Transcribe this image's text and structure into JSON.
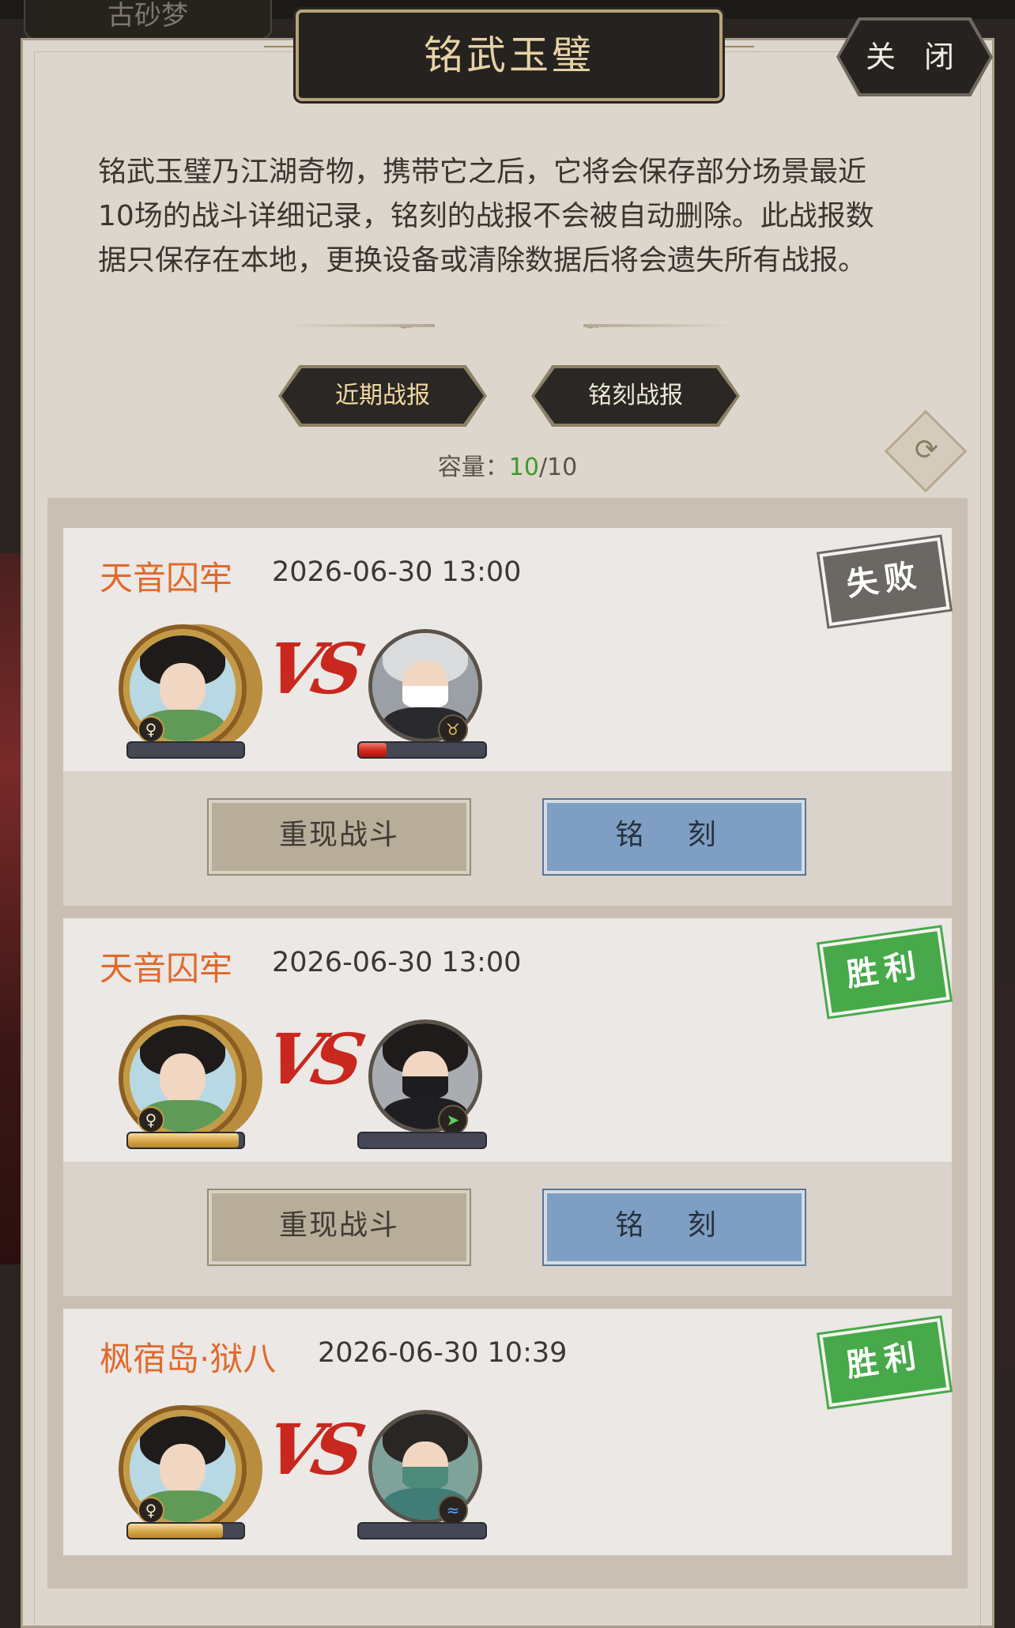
{
  "top_tab": {
    "label": "古砂梦"
  },
  "header": {
    "title": "铭武玉璧",
    "close_label": "关 闭"
  },
  "description": "铭武玉璧乃江湖奇物，携带它之后，它将会保存部分场景最近10场的战斗详细记录，铭刻的战报不会被自动删除。此战报数据只保存在本地，更换设备或清除数据后将会遗失所有战报。",
  "tabs": [
    {
      "label": "近期战报",
      "active": true
    },
    {
      "label": "铭刻战报",
      "active": false
    }
  ],
  "capacity": {
    "label": "容量：",
    "used": "10",
    "total": "/10"
  },
  "icons": {
    "refresh": "refresh-icon",
    "gender": "female-icon"
  },
  "colors": {
    "stage": "#df6a2c",
    "win": "#47a94a",
    "lose": "#6b6864",
    "engrave": "#7e9fc3",
    "replay": "#b7ad99"
  },
  "battles": [
    {
      "stage": "天音囚牢",
      "time": "2026-06-30 13:00",
      "result": "失败",
      "result_type": "lose",
      "player_hp": 0.0,
      "enemy_hp": 0.22,
      "enemy_class_icon": "ox-horn-icon",
      "replay_label": "重现战斗",
      "engrave_label": "铭 刻",
      "gender": "♀",
      "vs": "VS"
    },
    {
      "stage": "天音囚牢",
      "time": "2026-06-30 13:00",
      "result": "胜利",
      "result_type": "win",
      "player_hp": 0.96,
      "enemy_hp": 0.0,
      "enemy_class_icon": "green-arrow-icon",
      "replay_label": "重现战斗",
      "engrave_label": "铭 刻",
      "gender": "♀",
      "vs": "VS"
    },
    {
      "stage": "枫宿岛·狱八",
      "time": "2026-06-30 10:39",
      "result": "胜利",
      "result_type": "win",
      "player_hp": 0.82,
      "enemy_hp": 0.0,
      "enemy_class_icon": "blue-wave-icon",
      "replay_label": "",
      "engrave_label": "",
      "gender": "♀",
      "vs": "VS"
    }
  ]
}
